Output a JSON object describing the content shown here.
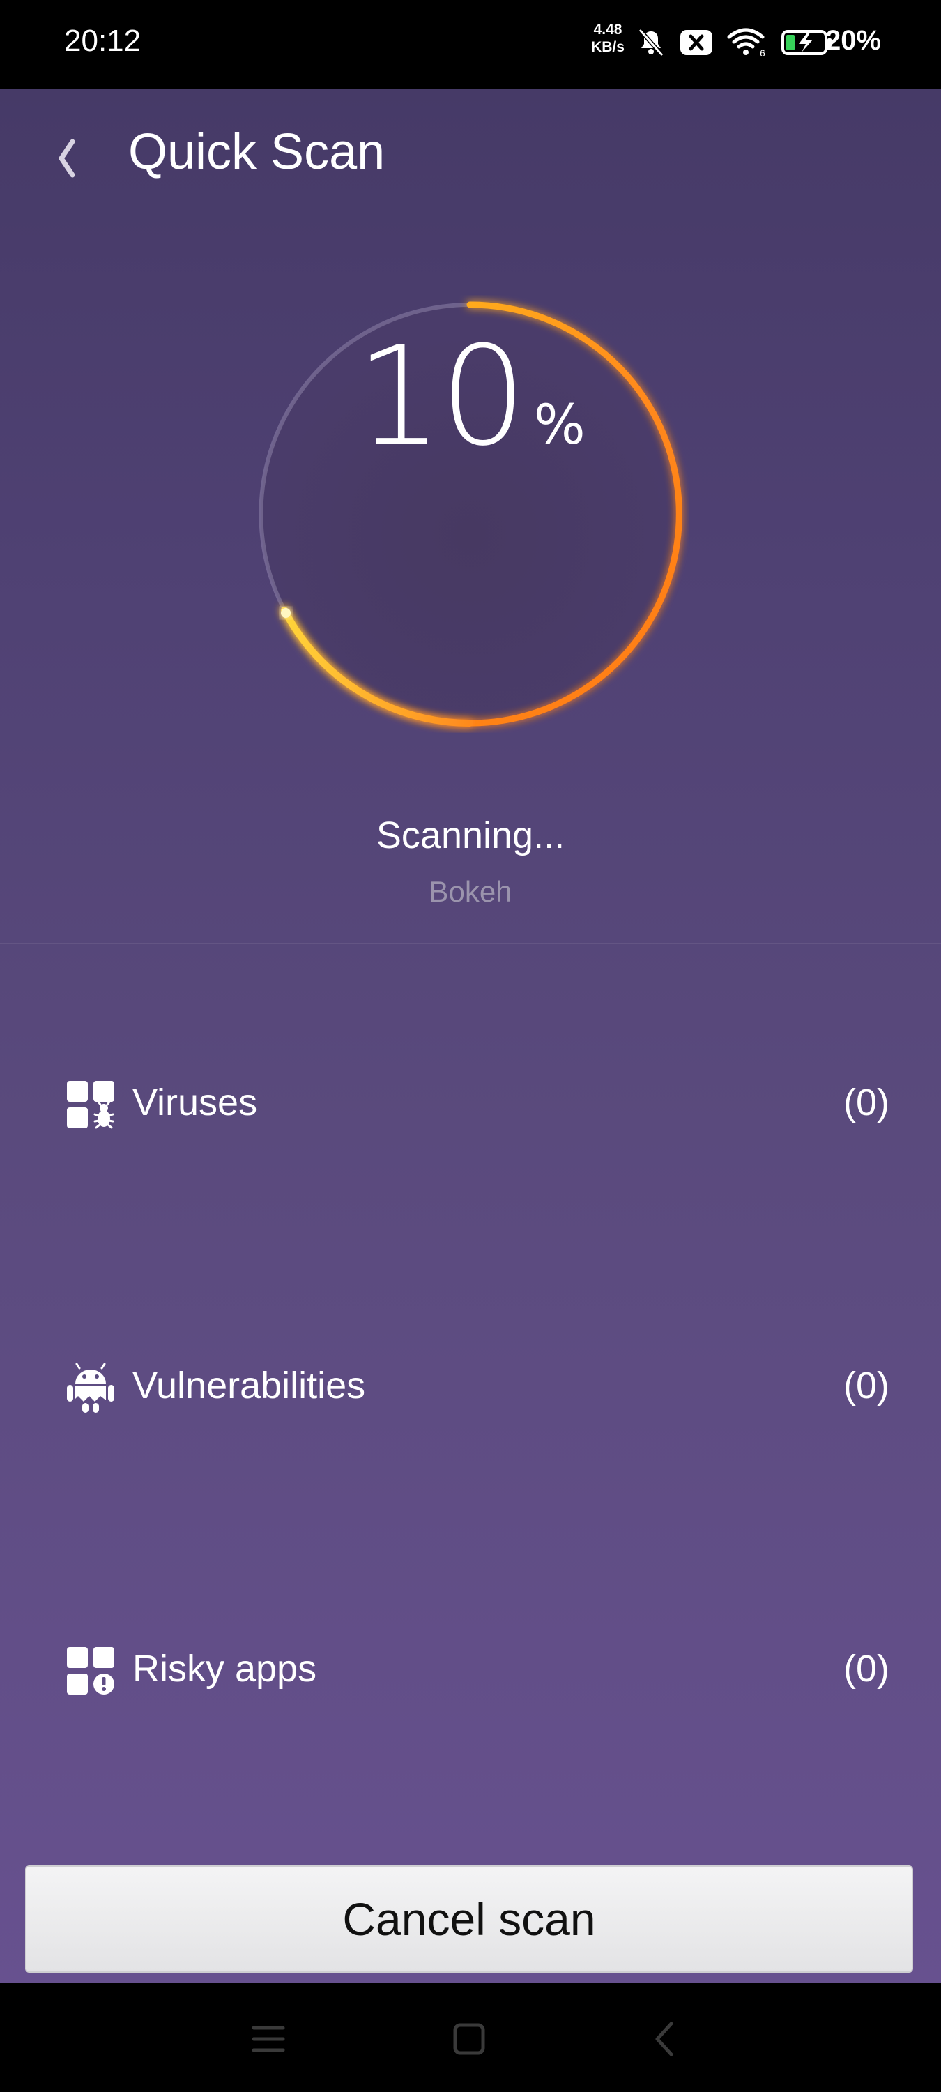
{
  "status_bar": {
    "time": "20:12",
    "net_speed_value": "4.48",
    "net_speed_unit": "KB/s",
    "battery_percent": "20%",
    "signal_sub": "6"
  },
  "header": {
    "title": "Quick Scan",
    "back_icon": "chevron-left-icon"
  },
  "progress": {
    "value": "10",
    "unit": "%",
    "fraction": 0.1
  },
  "scan": {
    "status": "Scanning...",
    "current_item": "Bokeh"
  },
  "results": [
    {
      "label": "Viruses",
      "count": "(0)",
      "icon": "virus-apps-icon"
    },
    {
      "label": "Vulnerabilities",
      "count": "(0)",
      "icon": "android-bug-icon"
    },
    {
      "label": "Risky apps",
      "count": "(0)",
      "icon": "risky-apps-icon"
    }
  ],
  "actions": {
    "cancel_label": "Cancel scan"
  },
  "colors": {
    "background_top": "#463a67",
    "background_bottom": "#67518f",
    "ring_orange": "#ff8a1e",
    "ring_yellow": "#ffd23a"
  }
}
